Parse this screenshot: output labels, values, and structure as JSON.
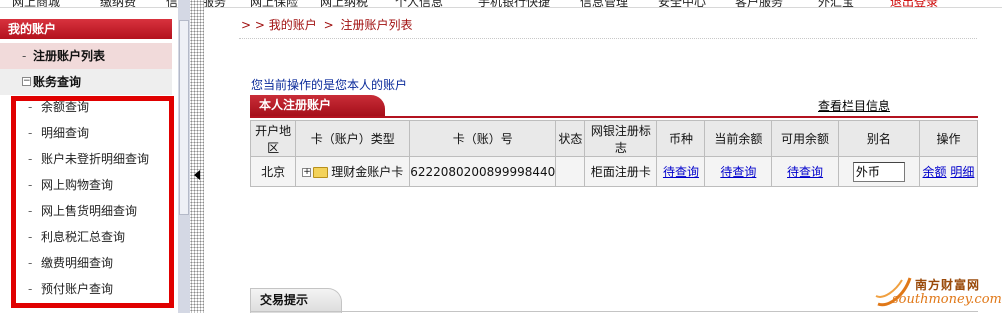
{
  "top_nav": {
    "items": [
      "网上商城",
      "缴纳费",
      "信用卡服务",
      "网上保险",
      "网上纳税",
      "个人信息",
      "手机银行快捷",
      "信息管理",
      "安全中心",
      "客户服务",
      "外汇宝",
      "退出登录"
    ]
  },
  "sidebar": {
    "title": "我的账户",
    "registered_list": "注册账户列表",
    "account_query": "账务查询",
    "items": [
      "余额查询",
      "明细查询",
      "账户未登折明细查询",
      "网上购物查询",
      "网上售货明细查询",
      "利息税汇总查询",
      "缴费明细查询",
      "预付账户查询"
    ]
  },
  "breadcrumb": {
    "prefix": "> >",
    "level1": "我的账户",
    "sep": ">",
    "level2": "注册账户列表"
  },
  "notice": "您当前操作的是您本人的账户",
  "accounts_tab": "本人注册账户",
  "column_info_link": "查看栏目信息",
  "table": {
    "headers": [
      "开户地区",
      "卡（账户）类型",
      "卡（账）号",
      "状态",
      "网银注册标志",
      "币种",
      "当前余额",
      "可用余额",
      "别名",
      "操作"
    ],
    "row": {
      "region": "北京",
      "expander": "+",
      "type": "理财金账户卡",
      "number": "6222080200899998440",
      "status": "",
      "reg_flag": "柜面注册卡",
      "currency": "待查询",
      "current_balance": "待查询",
      "available_balance": "待查询",
      "alias": "外币",
      "op_balance": "余额",
      "op_detail": "明细"
    }
  },
  "tips_tab": "交易提示",
  "watermark": {
    "cn": "南方财富网",
    "en": "southmoney.com"
  },
  "colors": {
    "brand_red": "#b31320",
    "highlight_red": "#e00000",
    "link_blue": "#0000cc"
  }
}
